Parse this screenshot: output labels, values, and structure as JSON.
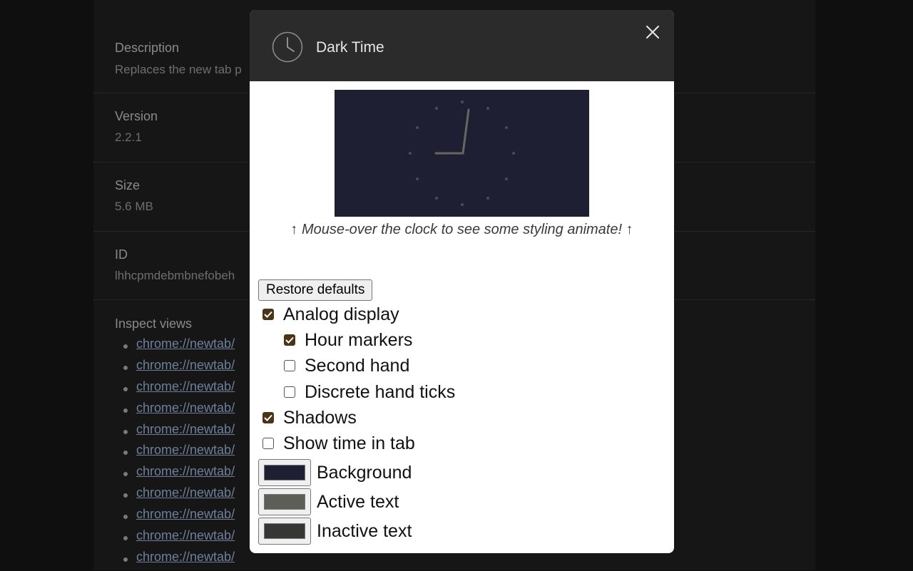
{
  "background_page": {
    "sections": [
      {
        "label": "Description",
        "value": "Replaces the new tab p"
      },
      {
        "label": "Version",
        "value": "2.2.1"
      },
      {
        "label": "Size",
        "value": "5.6 MB"
      },
      {
        "label": "ID",
        "value": "lhhcpmdebmbnefobeh"
      }
    ],
    "inspect_views_label": "Inspect views",
    "inspect_views": [
      "chrome://newtab/",
      "chrome://newtab/",
      "chrome://newtab/",
      "chrome://newtab/",
      "chrome://newtab/",
      "chrome://newtab/",
      "chrome://newtab/",
      "chrome://newtab/",
      "chrome://newtab/",
      "chrome://newtab/",
      "chrome://newtab/"
    ]
  },
  "modal": {
    "title": "Dark Time",
    "icon": "clock-icon",
    "close_icon": "close-icon",
    "caption": "↑ Mouse-over the clock to see some styling animate! ↑",
    "restore_label": "Restore defaults",
    "options": [
      {
        "label": "Analog display",
        "checked": true,
        "indent": 0
      },
      {
        "label": "Hour markers",
        "checked": true,
        "indent": 1
      },
      {
        "label": "Second hand",
        "checked": false,
        "indent": 1
      },
      {
        "label": "Discrete hand ticks",
        "checked": false,
        "indent": 1
      },
      {
        "label": "Shadows",
        "checked": true,
        "indent": 0
      },
      {
        "label": "Show time in tab",
        "checked": false,
        "indent": 0
      }
    ],
    "colors": [
      {
        "label": "Background",
        "value": "#1f1f33"
      },
      {
        "label": "Active text",
        "value": "#5e5e58"
      },
      {
        "label": "Inactive text",
        "value": "#363634"
      }
    ],
    "accent_color": "#4a3417"
  }
}
